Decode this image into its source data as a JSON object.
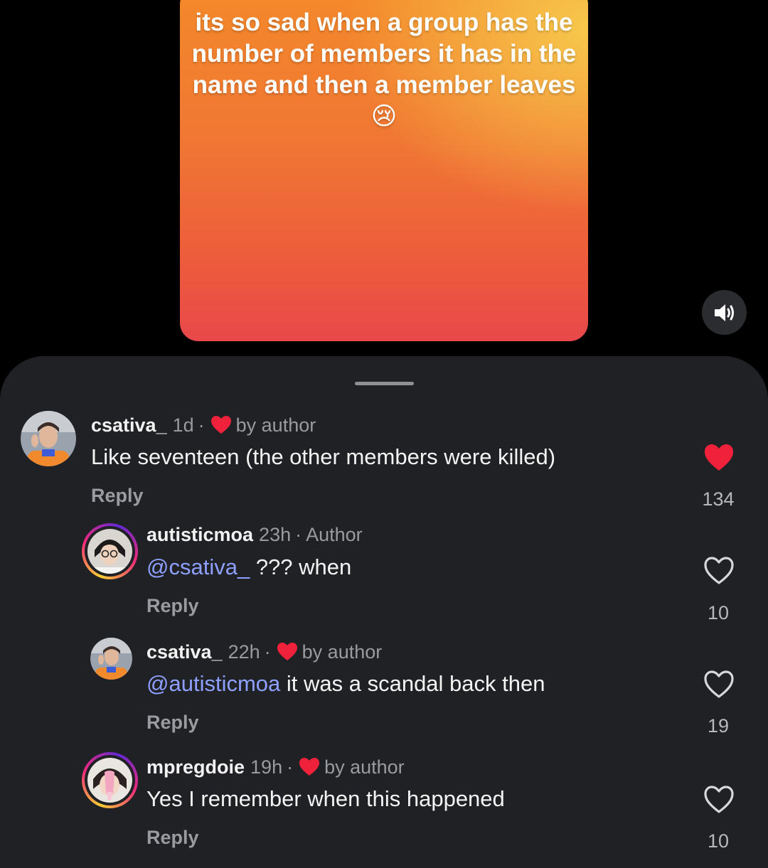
{
  "video": {
    "caption": "its so sad when a group has the number of members it has in the name and then a member leaves 😢"
  },
  "comments": [
    {
      "username": "csativa_",
      "time": "1d",
      "separator": "·",
      "badge": "by author",
      "mention": "",
      "text": "Like seventeen (the other members were killed)",
      "reply": "Reply",
      "likes": "134",
      "liked": true
    },
    {
      "username": "autisticmoa",
      "time": "23h",
      "separator": "·",
      "badge": "Author",
      "mention": "@csativa_",
      "text": " ??? when",
      "reply": "Reply",
      "likes": "10",
      "liked": false
    },
    {
      "username": "csativa_",
      "time": "22h",
      "separator": "·",
      "badge": "by author",
      "mention": "@autisticmoa",
      "text": " it was a scandal back then",
      "reply": "Reply",
      "likes": "19",
      "liked": false
    },
    {
      "username": "mpregdoie",
      "time": "19h",
      "separator": "·",
      "badge": "by author",
      "mention": "",
      "text": "Yes I remember when this happened",
      "reply": "Reply",
      "likes": "10",
      "liked": false
    }
  ],
  "colors": {
    "liked_heart": "#f0213b",
    "mention": "#8ea0ff",
    "sheet_bg": "#202124"
  },
  "icons": {
    "mute": "speaker-icon",
    "like": "heart-icon"
  }
}
